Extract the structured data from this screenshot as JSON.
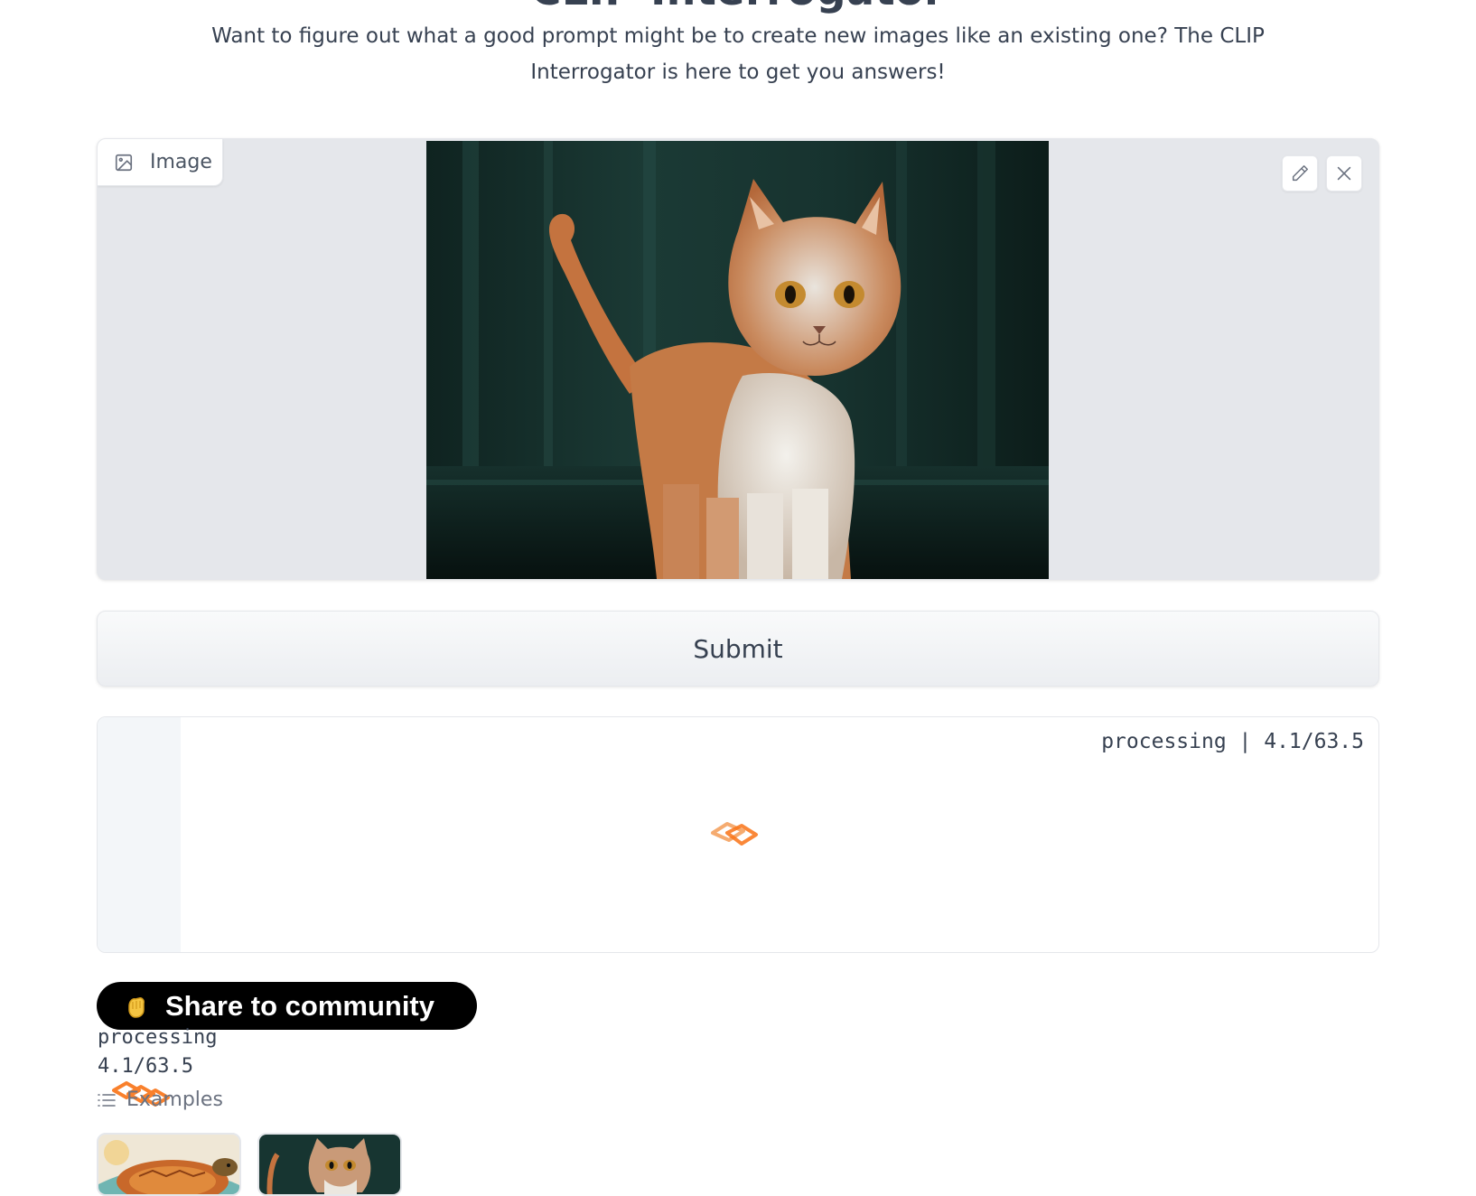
{
  "header": {
    "title": "CLIP Interrogator",
    "description": "Want to figure out what a good prompt might be to create new images like an existing one? The CLIP Interrogator is here to get you answers!"
  },
  "image_input": {
    "label": "Image",
    "icon": "image-icon",
    "tools": [
      "pencil-icon",
      "close-icon"
    ]
  },
  "submit": {
    "label": "Submit"
  },
  "output": {
    "status": "processing | 4.1/63.5"
  },
  "share": {
    "label": "Share to community",
    "icon": "clapping-hands-icon"
  },
  "overlap_status": {
    "line1": "processing",
    "line2": "4.1/63.5"
  },
  "examples": {
    "label": "Examples",
    "icon": "list-icon",
    "items": [
      "turtle-painting",
      "cat-painting"
    ]
  },
  "colors": {
    "accent_orange": "#f97316",
    "loader_orange": "#f4a261"
  }
}
